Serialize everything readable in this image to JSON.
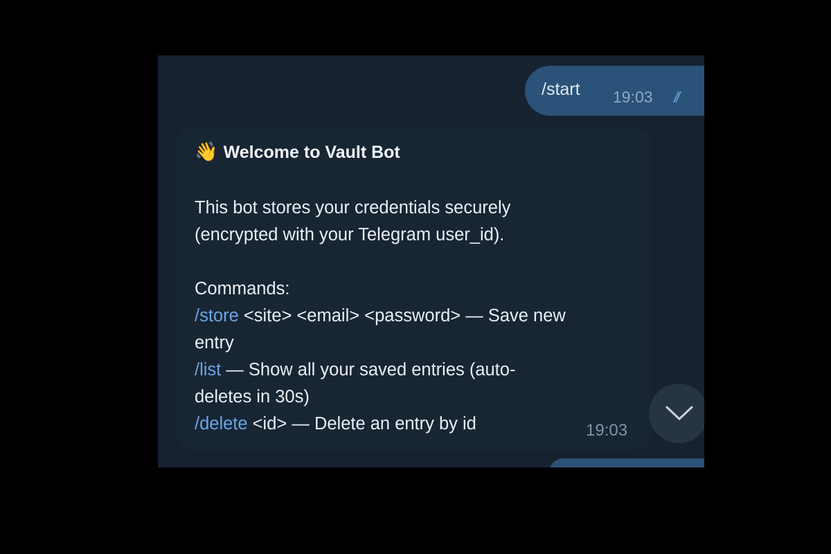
{
  "chat": {
    "outgoing": {
      "text": "/start",
      "time": "19:03",
      "status_icon": "double-check-icon"
    },
    "incoming": {
      "emoji": "👋",
      "title": "Welcome to Vault Bot",
      "intro_line_1": "This bot stores your credentials securely",
      "intro_line_2": "(encrypted with your Telegram user_id).",
      "commands_heading": "Commands:",
      "commands": [
        {
          "command": "/store",
          "text_line_1": " <site> <email> <password> — Save new",
          "text_line_2": "entry"
        },
        {
          "command": "/list",
          "text_line_1": " — Show all your saved entries (auto-",
          "text_line_2": "deletes in 30s)"
        },
        {
          "command": "/delete",
          "text_line_1": " <id> — Delete an entry by id"
        }
      ],
      "time": "19:03"
    },
    "scroll_down_icon": "chevron-down-icon"
  },
  "colors": {
    "page_background": "#000000",
    "chat_background": "#172231",
    "outgoing_bubble": "#2b5278",
    "incoming_bubble": "#182533",
    "command_link": "#69a6e6",
    "read_checks": "#68a5e0"
  }
}
